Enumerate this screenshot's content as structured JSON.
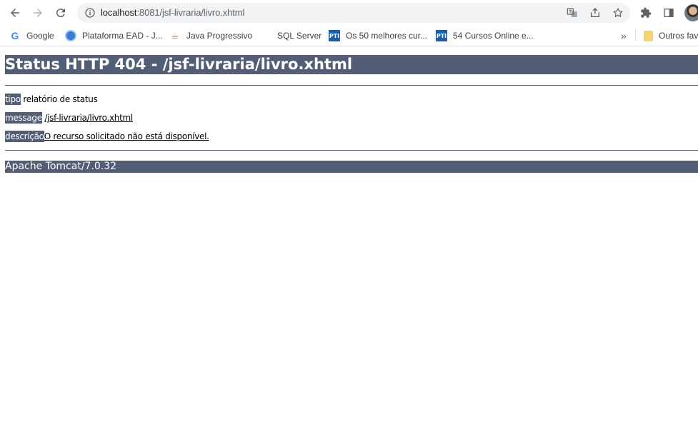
{
  "browser": {
    "url_host": "localhost",
    "url_rest": ":8081/jsf-livraria/livro.xhtml",
    "bookmarks": [
      {
        "label": "Google",
        "icon": "google-icon"
      },
      {
        "label": "Plataforma EAD - J...",
        "icon": "ead-icon"
      },
      {
        "label": "Java Progressivo",
        "icon": "java-icon"
      },
      {
        "label": "SQL Server",
        "icon": "microsoft-icon"
      },
      {
        "label": "Os 50 melhores cur...",
        "icon": "pti-icon"
      },
      {
        "label": "54 Cursos Online e...",
        "icon": "pti-icon"
      }
    ],
    "overflow_chevron": "»",
    "other_bookmarks_label": "Outros fav",
    "pti_text": "PTI"
  },
  "page": {
    "heading": "Status HTTP 404 - /jsf-livraria/livro.xhtml",
    "type_label": "tipo",
    "type_value": "relatório de status",
    "message_label": "message",
    "message_value": "/jsf-livraria/livro.xhtml",
    "description_label": "descrição",
    "description_value": "O recurso solicitado não está disponível.",
    "footer": "Apache Tomcat/7.0.32"
  },
  "colors": {
    "tomcat_header": "#525d76",
    "omnibox_bg": "#f1f3f4"
  }
}
